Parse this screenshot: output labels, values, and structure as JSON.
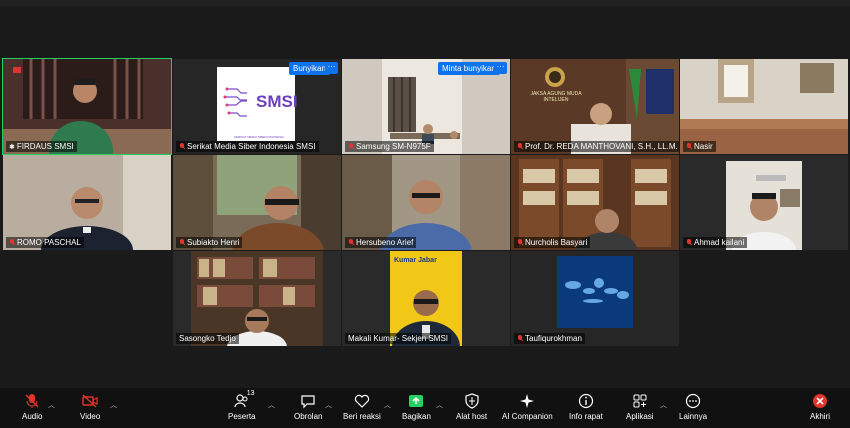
{
  "participants": [
    {
      "name": "FIRDAUS SMSI"
    },
    {
      "name": "Serikat Media Siber Indonesia SMSI",
      "logo_text": "SMSI",
      "logo_sub": "SERIKAT MEDIA SIBER INDONESIA",
      "badge": "Bunyikan"
    },
    {
      "name": "Samsung SM-N975F",
      "badge": "Minta bunyikan"
    },
    {
      "name": "Prof. Dr. REDA MANTHOVANI, S.H., LL.M.",
      "wall_text": "JAKSA AGUNG MUDA INTELIJEN"
    },
    {
      "name": "Nasir"
    },
    {
      "name": "ROMO PASCHAL"
    },
    {
      "name": "Subiakto Henri"
    },
    {
      "name": "Hersubeno Arief"
    },
    {
      "name": "Nurcholis Basyari"
    },
    {
      "name": "Ahmad kailani"
    },
    {
      "name": "Sasongko Tedjo"
    },
    {
      "name": "Makali Kumar- Sekjen SMSI",
      "bg_text": "Kumar Jabar"
    },
    {
      "name": "Taufiqurokhman"
    }
  ],
  "more_symbol": "···",
  "toolbar": {
    "audio": "Audio",
    "video": "Video",
    "participants": "Peserta",
    "participants_count": "13",
    "chat": "Obrolan",
    "react": "Beri reaksi",
    "share": "Bagikan",
    "host_tools": "Alat host",
    "ai": "AI Companion",
    "info": "Info rapat",
    "apps": "Aplikasi",
    "more": "Lainnya",
    "leave": "Akhiri"
  },
  "colors": {
    "accent": "#0e72ed",
    "share": "#23d160",
    "mute": "#e0352b",
    "leave": "#e0352b"
  }
}
